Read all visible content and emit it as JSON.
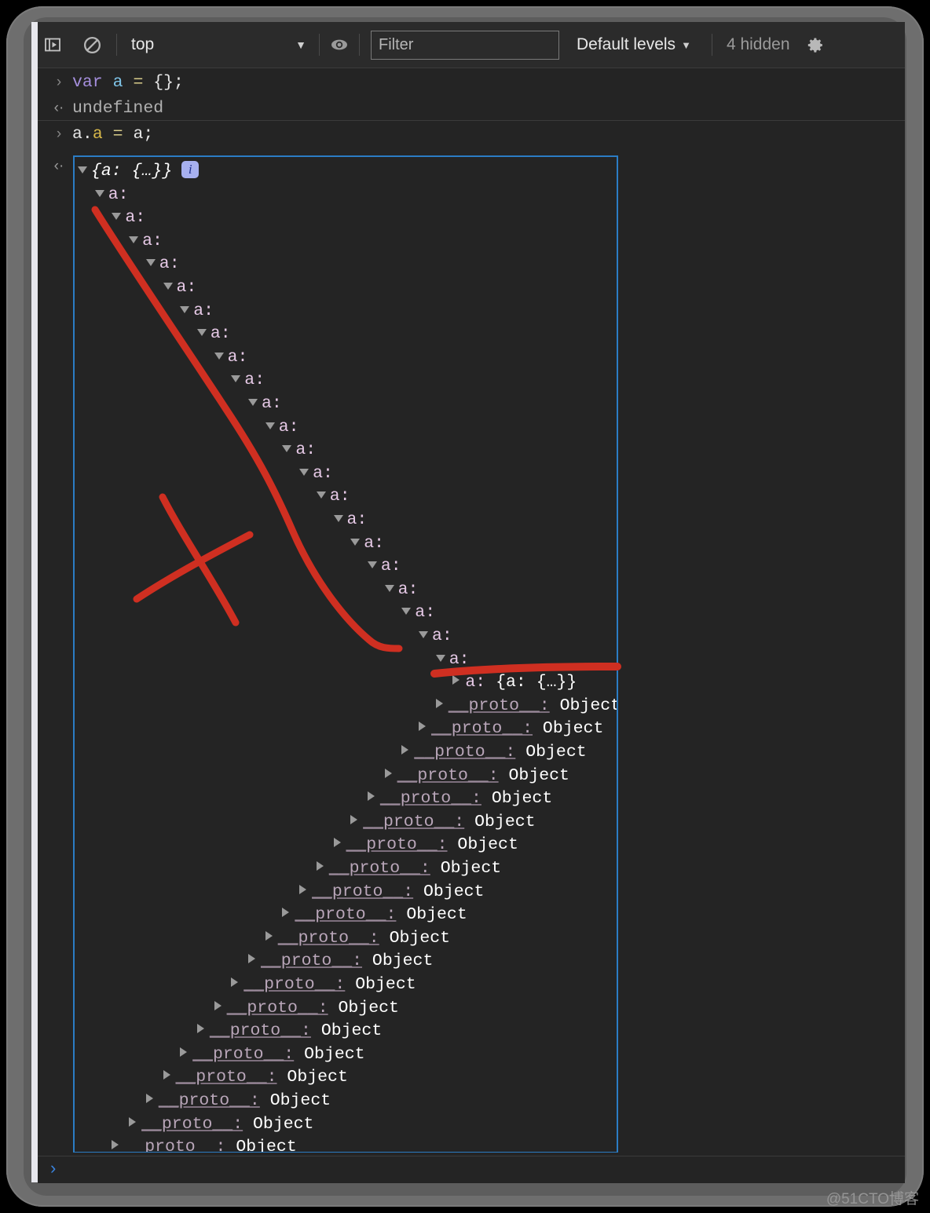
{
  "toolbar": {
    "sidebar_icon": "console-sidebar-icon",
    "clear_icon": "clear-console-icon",
    "context_value": "top",
    "caret": "▼",
    "eye_icon": "eye-icon",
    "filter_placeholder": "Filter",
    "filter_value": "",
    "levels_label": "Default levels",
    "levels_caret": "▼",
    "hidden_label": "4 hidden",
    "settings_icon": "gear-icon"
  },
  "console": {
    "entries": [
      {
        "marker": "›",
        "type": "command",
        "text": "var a = {};"
      },
      {
        "marker": "‹·",
        "type": "result",
        "text": "undefined"
      },
      {
        "marker": "›",
        "type": "command",
        "text": "a.a = a;"
      }
    ],
    "command1": {
      "kw": "var",
      "name": "a",
      "op": "=",
      "literal": "{};"
    },
    "command2": {
      "obj": "a.",
      "prop": "a",
      "op": "=",
      "value": "a;"
    },
    "undefined_text": "undefined",
    "result_marker": "‹·",
    "command_marker": "›"
  },
  "object_tree": {
    "root_preview": "{a: {…}}",
    "info_badge": "i",
    "expanded_key": "a:",
    "expanded_count": 21,
    "collapsed_key": "a:",
    "collapsed_value": "{a: {…}}",
    "proto_key": "__proto__:",
    "proto_value": "Object",
    "proto_count": 22
  },
  "prompt": {
    "caret": "›",
    "value": ""
  },
  "annotations": {
    "stroke_color": "#cf2f21",
    "marks": [
      "diagonal-line",
      "x-mark",
      "underline"
    ]
  },
  "watermark": "@51CTO博客",
  "colors": {
    "background": "#242424",
    "toolbar": "#2b2b2b",
    "selection_border": "#2b7cc4",
    "bezel": "#6e6e6e",
    "prompt_caret": "#3a84df",
    "info_badge": "#a7b0ef",
    "annotation_red": "#cf2f21"
  }
}
